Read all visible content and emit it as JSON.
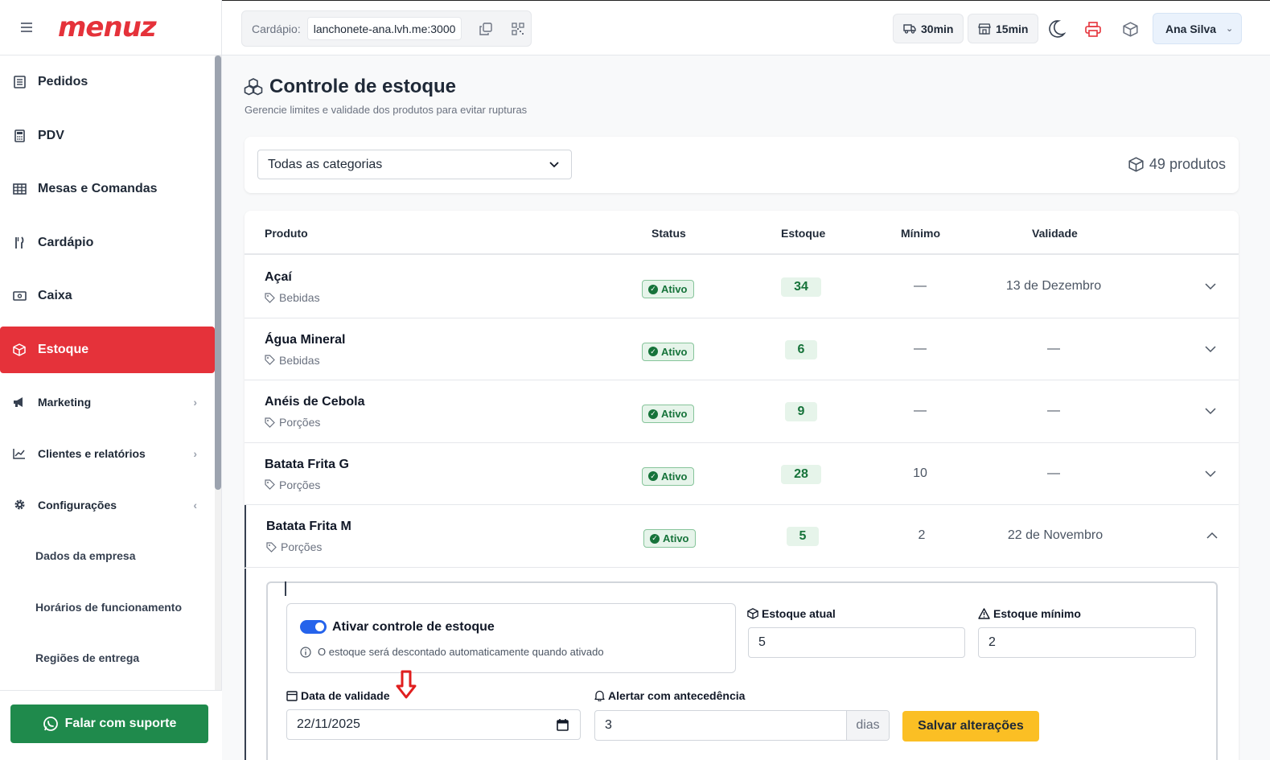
{
  "brand": {
    "logo": "menuz"
  },
  "sidebar": {
    "items": [
      {
        "label": "Pedidos",
        "icon": "receipt-icon"
      },
      {
        "label": "PDV",
        "icon": "calculator-icon"
      },
      {
        "label": "Mesas e Comandas",
        "icon": "table-icon"
      },
      {
        "label": "Cardápio",
        "icon": "utensils-icon"
      },
      {
        "label": "Caixa",
        "icon": "cash-icon"
      },
      {
        "label": "Estoque",
        "icon": "box-icon",
        "active": true
      },
      {
        "label": "Marketing",
        "icon": "megaphone-icon"
      },
      {
        "label": "Clientes e relatórios",
        "icon": "chart-line-icon"
      },
      {
        "label": "Configurações",
        "icon": "gear-icon"
      }
    ],
    "sub_items": [
      "Dados da empresa",
      "Horários de funcionamento",
      "Regiões de entrega"
    ],
    "support_label": "Falar com suporte"
  },
  "topbar": {
    "cardapio_label": "Cardápio:",
    "cardapio_url": "lanchonete-ana.lvh.me:3000",
    "delivery_time": "30min",
    "pickup_time": "15min",
    "user_name": "Ana Silva"
  },
  "page": {
    "title": "Controle de estoque",
    "subtitle": "Gerencie limites e validade dos produtos para evitar rupturas",
    "category_filter": "Todas as categorias",
    "product_count": "49 produtos"
  },
  "table": {
    "headers": {
      "product": "Produto",
      "status": "Status",
      "stock": "Estoque",
      "minimum": "Mínimo",
      "validity": "Validade"
    },
    "rows": [
      {
        "name": "Açaí",
        "category": "Bebidas",
        "status": "Ativo",
        "stock": "34",
        "minimum": "—",
        "validity": "13 de Dezembro"
      },
      {
        "name": "Água Mineral",
        "category": "Bebidas",
        "status": "Ativo",
        "stock": "6",
        "minimum": "—",
        "validity": "—"
      },
      {
        "name": "Anéis de Cebola",
        "category": "Porções",
        "status": "Ativo",
        "stock": "9",
        "minimum": "—",
        "validity": "—"
      },
      {
        "name": "Batata Frita G",
        "category": "Porções",
        "status": "Ativo",
        "stock": "28",
        "minimum": "10",
        "validity": "—"
      },
      {
        "name": "Batata Frita M",
        "category": "Porções",
        "status": "Ativo",
        "stock": "5",
        "minimum": "2",
        "validity": "22 de Novembro"
      }
    ]
  },
  "detail": {
    "toggle_label": "Ativar controle de estoque",
    "toggle_help": "O estoque será descontado automaticamente quando ativado",
    "current_stock_label": "Estoque atual",
    "current_stock_value": "5",
    "min_stock_label": "Estoque mínimo",
    "min_stock_value": "2",
    "expiry_label": "Data de validade",
    "expiry_value": "22/11/2025",
    "alert_label": "Alertar com antecedência",
    "alert_value": "3",
    "alert_suffix": "dias",
    "save_label": "Salvar alterações"
  },
  "colors": {
    "brand": "#e5323a",
    "success": "#16733a",
    "support": "#1f8a4c",
    "save": "#fbbf24",
    "toggle": "#2563eb"
  }
}
